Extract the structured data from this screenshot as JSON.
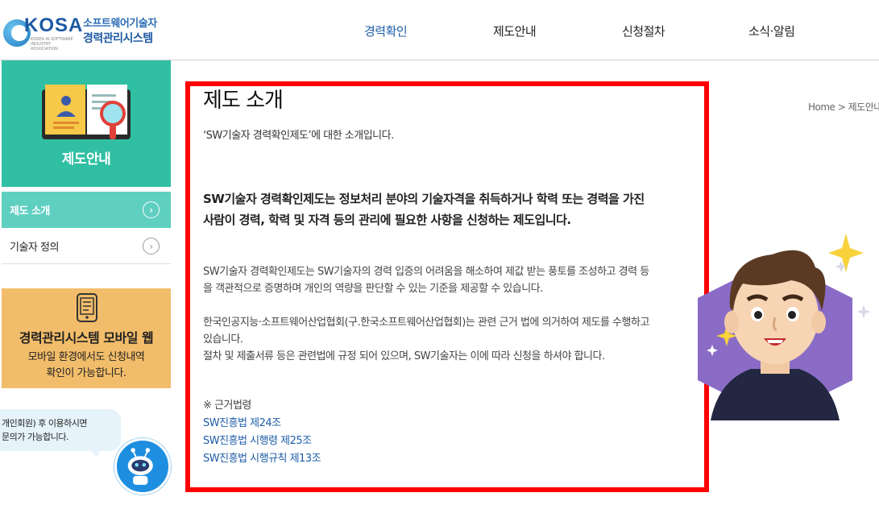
{
  "header": {
    "logo_text": "KOSA",
    "logo_subtext": "KOREA AI·SOFTWARE INDUSTRY ASSOCIATION",
    "site_title_line1": "소프트웨어기술자",
    "site_title_line2": "경력관리시스템",
    "nav": [
      {
        "label": "경력확인",
        "active": true
      },
      {
        "label": "제도안내",
        "active": false
      },
      {
        "label": "신청절차",
        "active": false
      },
      {
        "label": "소식·알림",
        "active": false
      }
    ]
  },
  "sidebar": {
    "hero_title": "제도안내",
    "items": [
      {
        "label": "제도 소개",
        "active": true
      },
      {
        "label": "기술자 정의",
        "active": false
      }
    ],
    "mobile": {
      "title": "경력관리시스템 모바일 웹",
      "desc_line1": "모바일 환경에서도 신청내역",
      "desc_line2": "확인이 가능합니다."
    },
    "chat": {
      "line1": "개인회원) 후 이용하시면",
      "line2": "문의가 가능합니다."
    }
  },
  "main": {
    "title": "제도 소개",
    "subtitle": "‘SW기술자 경력확인제도’에 대한 소개입니다.",
    "lead": "SW기술자 경력확인제도는 정보처리 분야의 기술자격을 취득하거나 학력 또는 경력을 가진 사람이 경력, 학력 및 자격 등의 관리에 필요한 사항을 신청하는 제도입니다.",
    "para1": "SW기술자 경력확인제도는 SW기술자의 경력 입증의 어려움을 해소하여 제값 받는 풍토를 조성하고 경력 등을 객관적으로 증명하며 개인의 역량을 판단할 수 있는 기준을 제공할 수 있습니다.",
    "para2a": "한국인공지능·소프트웨어산업협회(구.한국소프트웨어산업협회)는 관련 근거 법에 의거하여 제도를 수행하고 있습니다.",
    "para2b": "절차 및 제출서류 등은 관련법에 규정 되어 있으며, SW기술자는 이에 따라 신청을 하셔야 합니다.",
    "basis_title": "※ 근거법령",
    "basis_links": [
      "SW진흥법 제24조",
      "SW진흥법 시행령 제25조",
      "SW진흥법 시행규칙 제13조"
    ]
  },
  "breadcrumb": {
    "home": "Home",
    "current": "제도안내"
  },
  "colors": {
    "brand_blue": "#1e5da8",
    "sidebar_green": "#31bfa4",
    "menu_active": "#5fcfc0",
    "mobile_box": "#f2bd6a",
    "highlight_red": "#ff0000"
  }
}
